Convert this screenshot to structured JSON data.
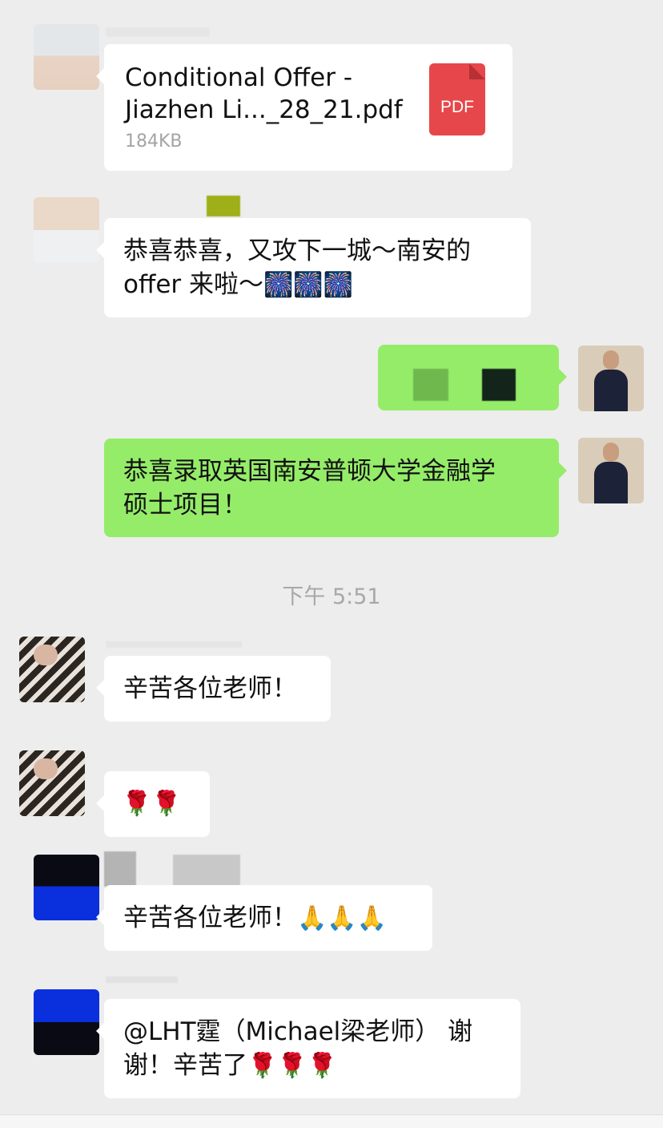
{
  "messages": {
    "file": {
      "name_line1": "Conditional Offer -",
      "name_line2": "Jiazhen Li..._28_21.pdf",
      "size": "184KB",
      "icon_label": "PDF"
    },
    "msg_congrats": {
      "line1": "恭喜恭喜，又攻下一城～南安的",
      "line2": "offer 来啦～",
      "emoji": "🎆🎆🎆"
    },
    "msg_admission": {
      "line1": "恭喜录取英国南安普顿大学金融学",
      "line2": "硕士项目！"
    },
    "timestamp": "下午 5:51",
    "msg_thanks1": {
      "text": "辛苦各位老师！"
    },
    "msg_roses": {
      "emoji": "🌹🌹"
    },
    "msg_thanks2": {
      "text": "辛苦各位老师！",
      "emoji": "🙏🙏🙏"
    },
    "msg_mention": {
      "line1": "@LHT霆（Michael梁老师） 谢",
      "line2": "谢！辛苦了",
      "emoji": "🌹🌹🌹"
    }
  },
  "colors": {
    "background": "#ededed",
    "bubble_in": "#ffffff",
    "bubble_out": "#95ec69",
    "pdf_red": "#e6474a",
    "timestamp": "#a8a8a8"
  },
  "icons": [
    "pdf-file-icon",
    "fireworks-emoji",
    "rose-emoji",
    "pray-emoji"
  ]
}
